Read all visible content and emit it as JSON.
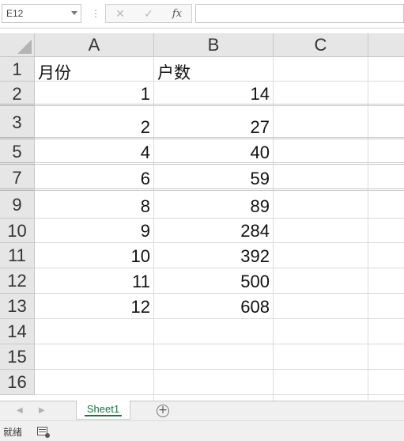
{
  "formula_bar": {
    "name_box": "E12",
    "cancel_icon": "✕",
    "enter_icon": "✓",
    "function_label": "fx",
    "separator": "⋮",
    "formula": ""
  },
  "columns": [
    "A",
    "B",
    "C"
  ],
  "rows": [
    {
      "num": "1",
      "a": "月份",
      "b": "户数",
      "hidden_below": false
    },
    {
      "num": "2",
      "a": "1",
      "b": "14",
      "hidden_below": true
    },
    {
      "num": "3",
      "a": "2",
      "b": "27",
      "hidden_below": true
    },
    {
      "num": "5",
      "a": "4",
      "b": "40",
      "hidden_below": true
    },
    {
      "num": "7",
      "a": "6",
      "b": "59",
      "hidden_below": true
    },
    {
      "num": "9",
      "a": "8",
      "b": "89",
      "hidden_below": false
    },
    {
      "num": "10",
      "a": "9",
      "b": "284",
      "hidden_below": false
    },
    {
      "num": "11",
      "a": "10",
      "b": "392",
      "hidden_below": false
    },
    {
      "num": "12",
      "a": "11",
      "b": "500",
      "hidden_below": false
    },
    {
      "num": "13",
      "a": "12",
      "b": "608",
      "hidden_below": false
    },
    {
      "num": "14",
      "a": "",
      "b": "",
      "hidden_below": false
    },
    {
      "num": "15",
      "a": "",
      "b": "",
      "hidden_below": false
    },
    {
      "num": "16",
      "a": "",
      "b": "",
      "hidden_below": false
    }
  ],
  "sheet_tabs": {
    "prev_icon": "◀",
    "next_icon": "▶",
    "active": "Sheet1",
    "add_icon": "+"
  },
  "status_bar": {
    "status": "就绪"
  },
  "colors": {
    "tab_accent": "#1e7145",
    "header_bg": "#e6e6e6",
    "gridline": "#dadada"
  }
}
